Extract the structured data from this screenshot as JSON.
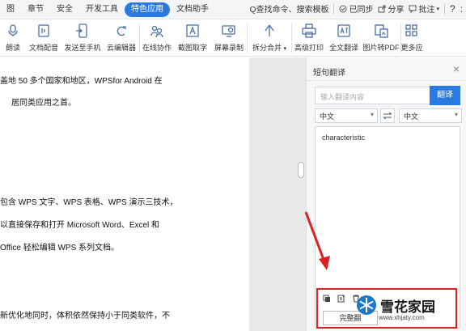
{
  "menubar": {
    "items": [
      {
        "label": "图"
      },
      {
        "label": "章节"
      },
      {
        "label": "安全"
      },
      {
        "label": "开发工具"
      },
      {
        "label": "特色应用"
      },
      {
        "label": "文档助手"
      }
    ],
    "search": "Q查找命令、搜索模板",
    "sync": "已同步",
    "share": "分享",
    "annotate": "批注",
    "help": "?",
    "more": ":"
  },
  "toolbar": {
    "items": [
      {
        "label": "朗读",
        "icon": "microphone-icon"
      },
      {
        "label": "文档配音",
        "icon": "audio-doc-icon"
      },
      {
        "label": "发送至手机",
        "icon": "send-to-phone-icon"
      },
      {
        "label": "云编辑器",
        "icon": "cloud-editor-icon"
      },
      {
        "label": "在线协作",
        "icon": "collaboration-icon"
      },
      {
        "label": "截图取字",
        "icon": "ocr-icon"
      },
      {
        "label": "屏幕录制",
        "icon": "screen-record-icon"
      },
      {
        "label": "拆分合并",
        "icon": "split-merge-icon"
      },
      {
        "label": "高级打印",
        "icon": "print-icon"
      },
      {
        "label": "全文翻译",
        "icon": "translate-icon"
      },
      {
        "label": "图片转PDF",
        "icon": "image-to-pdf-icon"
      },
      {
        "label": "更多应",
        "icon": "more-apps-icon"
      }
    ]
  },
  "document": {
    "lines": [
      "盖地 50 多个国家和地区，WPSfor Android 在",
      "居同类应用之首。",
      "包含  WPS 文字、WPS 表格、WPS 演示三技术，",
      "以直接保存和打开  Microsoft Word、Excel  和",
      "Office 轻松编辑 WPS 系列文档。",
      "新优化地同时，体积依然保持小于同类软件，不"
    ]
  },
  "panel": {
    "title": "短句翻译",
    "close": "×",
    "input_placeholder": "输入翻译内容",
    "translate_button": "翻译",
    "source_lang": "中文",
    "target_lang": "中文",
    "result": "characteristic",
    "action_button": "完整翻"
  },
  "watermark": {
    "text": "雪花家园",
    "url": "www.xhjaty.com"
  },
  "colors": {
    "accent": "#2a7ae2",
    "highlight": "#e02020"
  }
}
